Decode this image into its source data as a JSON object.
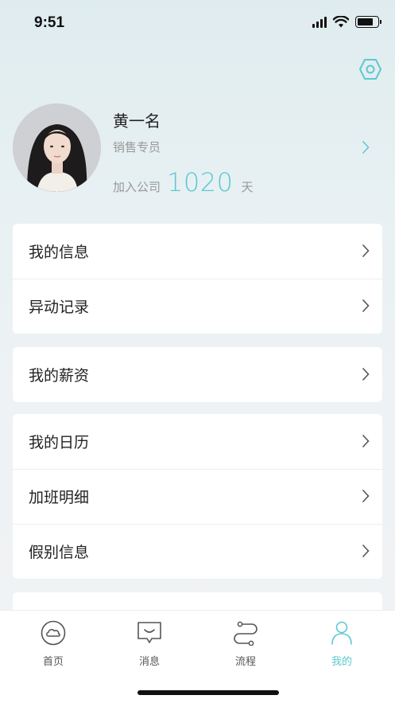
{
  "status": {
    "time": "9:51"
  },
  "profile": {
    "name": "黄一名",
    "role": "销售专员",
    "join_prefix": "加入公司",
    "join_days": "1020",
    "join_suffix": "天"
  },
  "menu": {
    "my_info": "我的信息",
    "change_record": "异动记录",
    "my_salary": "我的薪资",
    "my_calendar": "我的日历",
    "overtime_detail": "加班明细",
    "leave_info": "假别信息"
  },
  "tabs": [
    {
      "label": "首页",
      "icon": "cloud-circle-icon"
    },
    {
      "label": "消息",
      "icon": "message-bubble-icon"
    },
    {
      "label": "流程",
      "icon": "flow-icon"
    },
    {
      "label": "我的",
      "icon": "person-icon"
    }
  ],
  "colors": {
    "accent": "#5ec8d1",
    "text": "#222222",
    "muted": "#999999"
  }
}
